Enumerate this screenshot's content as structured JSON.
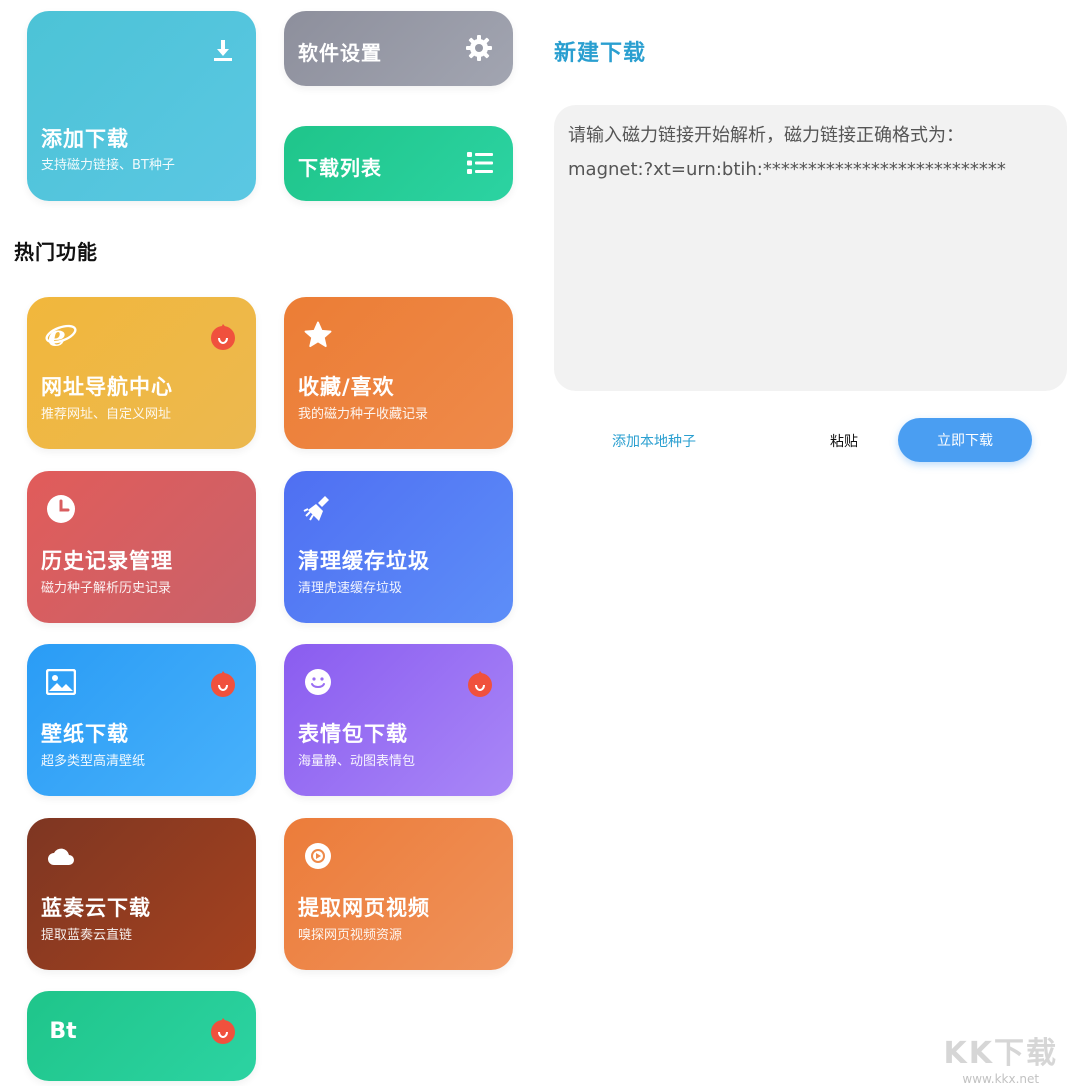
{
  "top_cards": {
    "add": {
      "title": "添加下载",
      "subtitle": "支持磁力链接、BT种子",
      "icon": "download-icon"
    },
    "settings": {
      "title": "软件设置",
      "icon": "gear-icon"
    },
    "list": {
      "title": "下载列表",
      "icon": "list-icon"
    }
  },
  "section": {
    "title": "热门功能"
  },
  "features": [
    {
      "title": "网址导航中心",
      "subtitle": "推荐网址、自定义网址",
      "icon": "browser-e-icon",
      "hot": true
    },
    {
      "title": "收藏/喜欢",
      "subtitle": "我的磁力种子收藏记录",
      "icon": "star-icon",
      "hot": false
    },
    {
      "title": "历史记录管理",
      "subtitle": "磁力种子解析历史记录",
      "icon": "clock-icon",
      "hot": false
    },
    {
      "title": "清理缓存垃圾",
      "subtitle": "清理虎速缓存垃圾",
      "icon": "broom-icon",
      "hot": false
    },
    {
      "title": "壁纸下载",
      "subtitle": "超多类型高清壁纸",
      "icon": "image-icon",
      "hot": true
    },
    {
      "title": "表情包下载",
      "subtitle": "海量静、动图表情包",
      "icon": "smiley-icon",
      "hot": true
    },
    {
      "title": "蓝奏云下载",
      "subtitle": "提取蓝奏云直链",
      "icon": "cloud-icon",
      "hot": false
    },
    {
      "title": "提取网页视频",
      "subtitle": "嗅探网页视频资源",
      "icon": "video-icon",
      "hot": false
    },
    {
      "title": "",
      "subtitle": "",
      "icon_text": "Bt",
      "icon": "bt-icon",
      "hot": true
    }
  ],
  "new_download": {
    "title": "新建下载",
    "placeholder_line1": "请输入磁力链接开始解析，磁力链接正确格式为：",
    "placeholder_line2": "magnet:?xt=urn:btih:***************************",
    "add_local_label": "添加本地种子",
    "paste_label": "粘贴",
    "download_now_label": "立即下载"
  },
  "watermark": {
    "text": "KK下载",
    "url": "www.kkx.net"
  },
  "colors": {
    "accent": "#2a9fd0",
    "button_blue": "#4a9ef2",
    "hot": "#f0513d"
  }
}
